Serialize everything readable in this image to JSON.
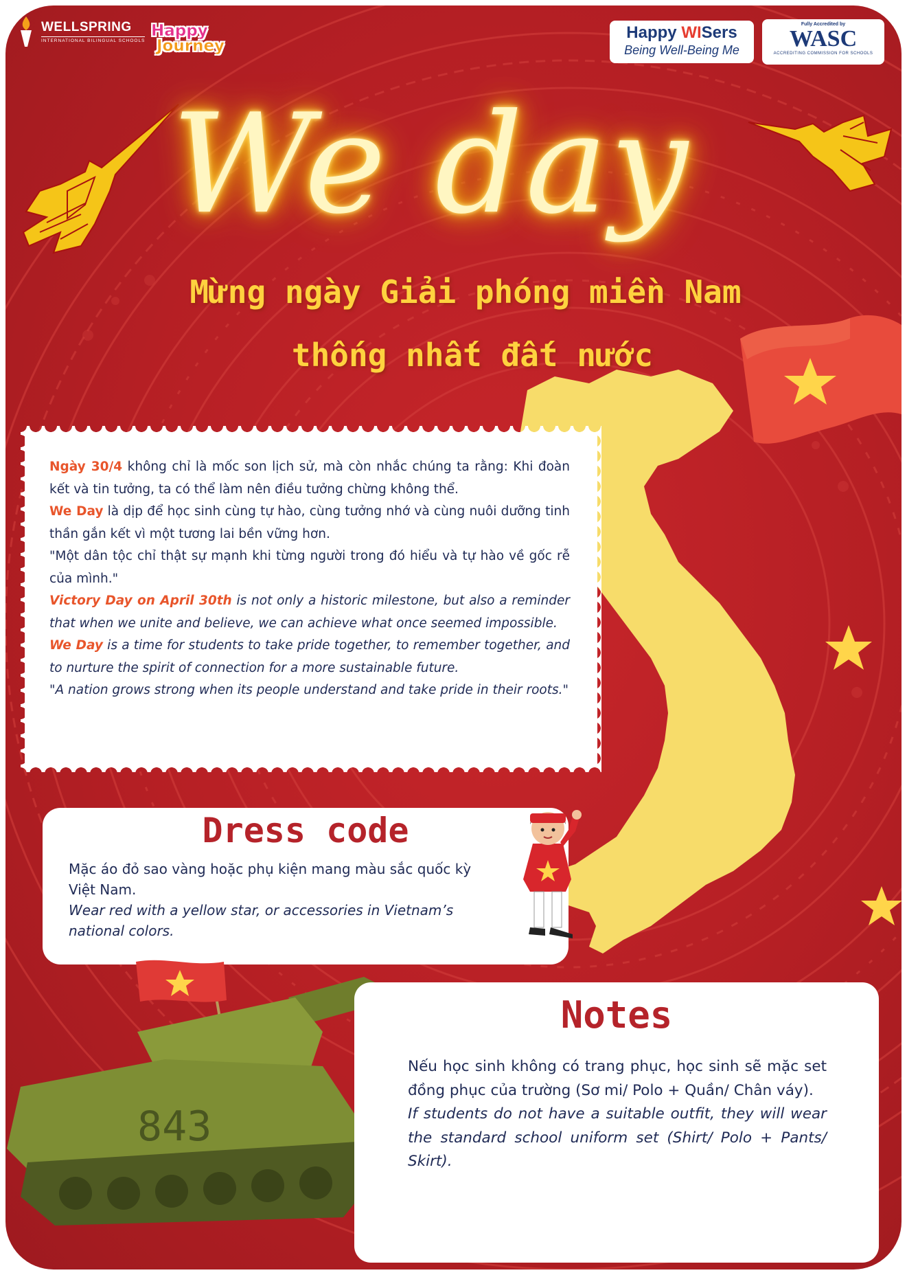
{
  "header": {
    "wellspring": {
      "name": "WELLSPRING",
      "sub": "INTERNATIONAL BILINGUAL SCHOOLS"
    },
    "happy_journey": {
      "line1": "Happy",
      "line2": "Journey"
    },
    "happy_wisers": {
      "part1": "Happy ",
      "part2": "WI",
      "part3": "Sers",
      "tagline": "Being Well-Being Me"
    },
    "wasc": {
      "top": "Fully Accredited by",
      "name": "WASC",
      "bottom": "ACCREDITING COMMISSION FOR SCHOOLS"
    }
  },
  "title": {
    "main": "We day",
    "subtitle_line1": "Mừng ngày Giải phóng miền Nam",
    "subtitle_line2": "thống nhất đất nước"
  },
  "intro": {
    "p1_highlight": "Ngày 30/4",
    "p1_text": " không chỉ là mốc son lịch sử, mà còn nhắc chúng ta rằng: Khi đoàn kết và tin tưởng, ta có thể làm nên điều tưởng chừng không thể.",
    "p2_highlight": "We Day",
    "p2_text": " là dịp để học sinh cùng tự hào, cùng tưởng nhớ và cùng nuôi dưỡng tinh thần gắn kết vì một tương lai bền vững hơn.",
    "p3_text": "\"Một dân tộc chỉ thật sự mạnh khi từng người trong đó hiểu và tự hào về gốc rễ của mình.\"",
    "p4_highlight": "Victory Day on April 30th",
    "p4_text": " is not only a historic milestone, but also a reminder that when we unite and believe, we can achieve what once seemed impossible.",
    "p5_highlight": "We Day",
    "p5_text": " is a time for students to take pride together, to remember together, and to nurture the spirit of connection for a more sustainable future.",
    "p6_text": "\"A nation grows strong when its people understand and take pride in their roots.\""
  },
  "dress_code": {
    "title": "Dress code",
    "vi": "Mặc áo đỏ sao vàng hoặc phụ kiện mang màu sắc quốc kỳ Việt Nam.",
    "en": "Wear red with a yellow star, or accessories in Vietnam’s national colors."
  },
  "notes": {
    "title": "Notes",
    "vi": "Nếu học sinh không có trang phục, học sinh sẽ mặc set đồng phục của trường (Sơ mi/ Polo + Quần/ Chân váy).",
    "en": "If students do not have a suitable outfit, they will wear the standard school uniform set (Shirt/ Polo + Pants/ Skirt)."
  },
  "tank": {
    "number": "843"
  },
  "colors": {
    "background_red": "#b51f24",
    "gold": "#ffd23f",
    "map_yellow": "#f7dc6a",
    "title_red": "#b5232a",
    "highlight_orange": "#e8552b",
    "text_navy": "#1f2a55"
  }
}
